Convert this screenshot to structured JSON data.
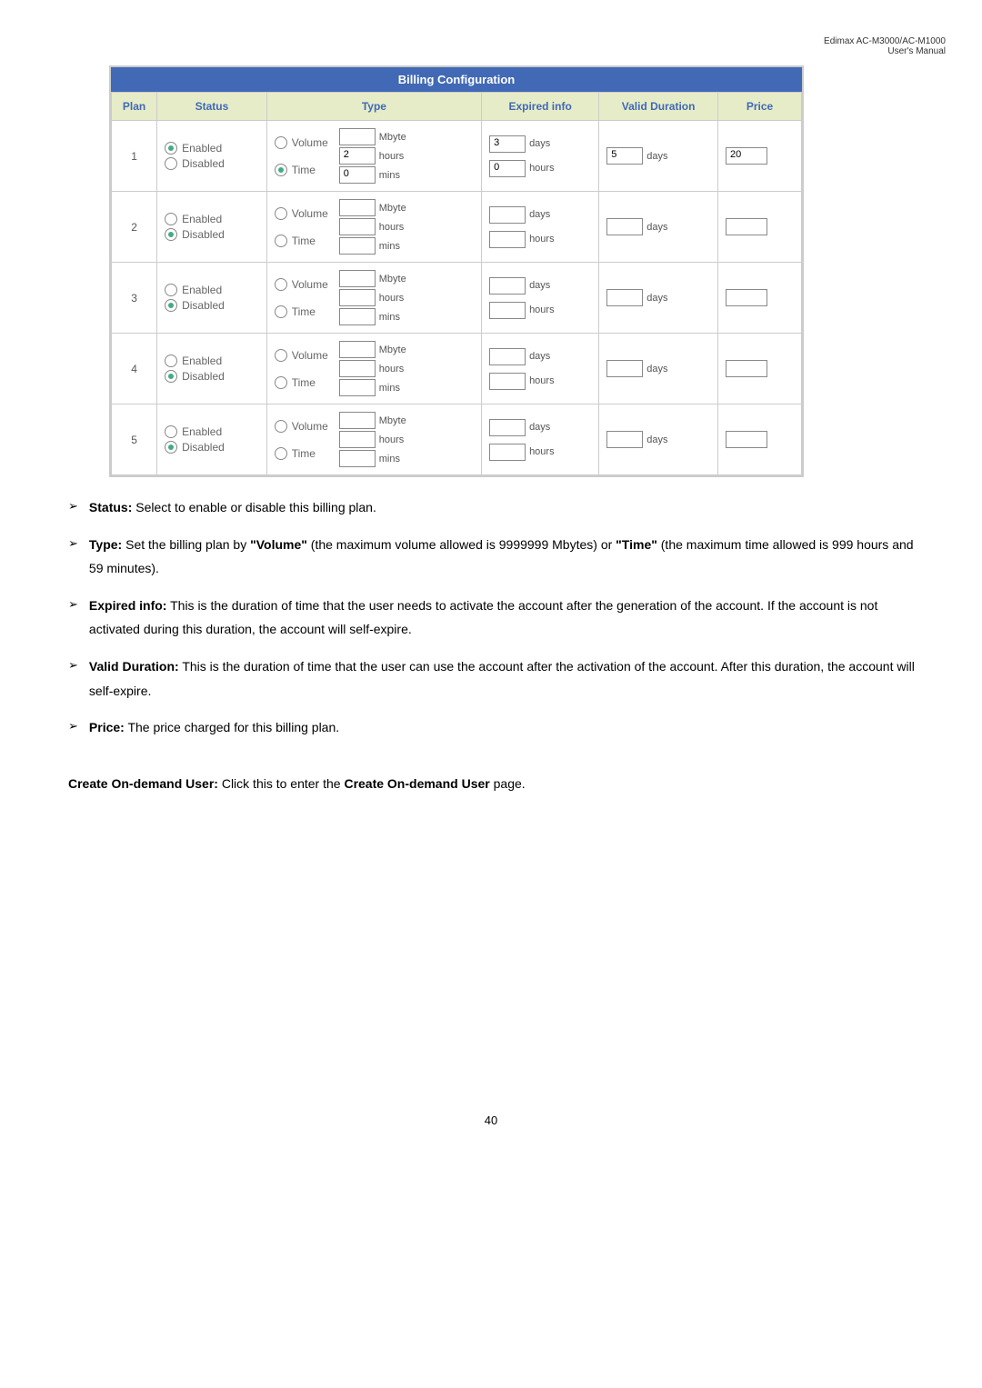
{
  "header": {
    "line1": "Edimax  AC-M3000/AC-M1000",
    "line2": "User's  Manual"
  },
  "table": {
    "title": "Billing Configuration",
    "headers": [
      "Plan",
      "Status",
      "Type",
      "Expired info",
      "Valid Duration",
      "Price"
    ],
    "labels": {
      "enabled": "Enabled",
      "disabled": "Disabled",
      "volume": "Volume",
      "time": "Time",
      "mbyte": "Mbyte",
      "hours": "hours",
      "mins": "mins",
      "days": "days"
    },
    "rows": [
      {
        "plan": "1",
        "status": "enabled",
        "type_selected": "time",
        "mbyte": "",
        "hours": "2",
        "mins": "0",
        "exp_days": "3",
        "exp_hours": "0",
        "valid_days": "5",
        "price": "20"
      },
      {
        "plan": "2",
        "status": "disabled",
        "type_selected": "none",
        "mbyte": "",
        "hours": "",
        "mins": "",
        "exp_days": "",
        "exp_hours": "",
        "valid_days": "",
        "price": ""
      },
      {
        "plan": "3",
        "status": "disabled",
        "type_selected": "none",
        "mbyte": "",
        "hours": "",
        "mins": "",
        "exp_days": "",
        "exp_hours": "",
        "valid_days": "",
        "price": ""
      },
      {
        "plan": "4",
        "status": "disabled",
        "type_selected": "none",
        "mbyte": "",
        "hours": "",
        "mins": "",
        "exp_days": "",
        "exp_hours": "",
        "valid_days": "",
        "price": ""
      },
      {
        "plan": "5",
        "status": "disabled",
        "type_selected": "none",
        "mbyte": "",
        "hours": "",
        "mins": "",
        "exp_days": "",
        "exp_hours": "",
        "valid_days": "",
        "price": ""
      }
    ]
  },
  "bullets": {
    "status": {
      "label": "Status:",
      "text": " Select to enable or disable this billing plan."
    },
    "type": {
      "label": "Type:",
      "text1": " Set the billing plan by ",
      "bold1": "\"Volume\"",
      "text2": " (the maximum volume allowed is 9999999 Mbytes) or ",
      "bold2": "\"Time\"",
      "text3": " (the maximum time allowed is 999 hours and 59 minutes)."
    },
    "expired": {
      "label": "Expired info:",
      "text": " This is the duration of time that the user needs to activate the account after the generation of the account. If the account is not activated during this duration, the account will self-expire."
    },
    "valid": {
      "label": "Valid Duration:",
      "text": " This is the duration of time that the user can use the account after the activation of the account. After this duration, the account will self-expire."
    },
    "price": {
      "label": "Price:",
      "text": " The price charged for this billing plan."
    }
  },
  "create": {
    "bold1": "Create On-demand User:",
    "text1": " Click this to enter the ",
    "bold2": "Create On-demand User",
    "text2": " page."
  },
  "page_num": "40"
}
